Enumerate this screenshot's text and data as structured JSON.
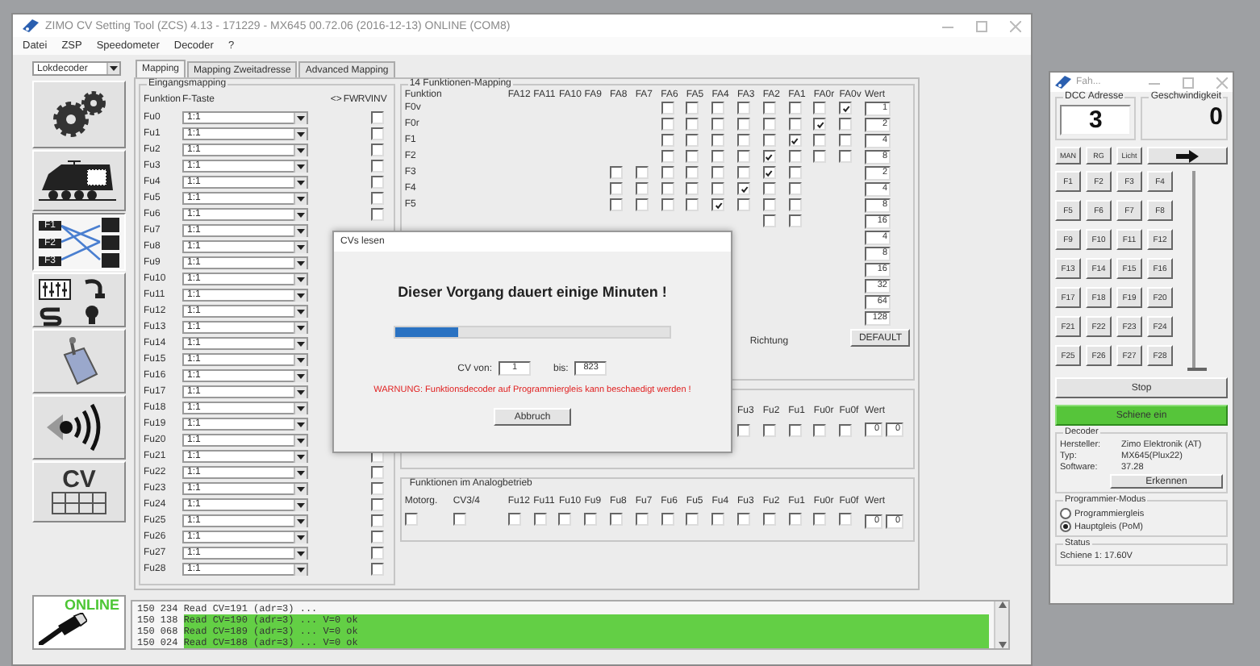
{
  "window": {
    "title": "ZIMO CV Setting Tool (ZCS) 4.13 - 171229 - MX645 00.72.06 (2016-12-13) ONLINE (COM8)"
  },
  "menu": [
    "Datei",
    "ZSP",
    "Speedometer",
    "Decoder",
    "?"
  ],
  "decoder_type": {
    "value": "Lokdecoder"
  },
  "tools": [
    {
      "kind": "gears",
      "selected": false
    },
    {
      "kind": "locomotive",
      "selected": false
    },
    {
      "kind": "mapping",
      "selected": true,
      "labels": [
        "F1",
        "F2",
        "F3"
      ]
    },
    {
      "kind": "settings",
      "selected": false
    },
    {
      "kind": "servo",
      "selected": false
    },
    {
      "kind": "sound",
      "selected": false
    },
    {
      "kind": "cv",
      "selected": false,
      "label": "CV"
    }
  ],
  "tabs": [
    {
      "label": "Mapping",
      "selected": true
    },
    {
      "label": "Mapping Zweitadresse",
      "selected": false
    },
    {
      "label": "Advanced Mapping",
      "selected": false
    }
  ],
  "input_mapping": {
    "title": "Eingangsmapping",
    "columns": [
      "Funktion",
      "F-Taste",
      "<>",
      "FW",
      "RV",
      "INV"
    ],
    "rows": [
      {
        "label": "Fu0",
        "key": "1:1",
        "inv": false
      },
      {
        "label": "Fu1",
        "key": "1:1",
        "inv": false
      },
      {
        "label": "Fu2",
        "key": "1:1",
        "inv": false
      },
      {
        "label": "Fu3",
        "key": "1:1",
        "inv": false
      },
      {
        "label": "Fu4",
        "key": "1:1",
        "inv": false
      },
      {
        "label": "Fu5",
        "key": "1:1",
        "inv": false
      },
      {
        "label": "Fu6",
        "key": "1:1",
        "inv": false
      },
      {
        "label": "Fu7",
        "key": "1:1"
      },
      {
        "label": "Fu8",
        "key": "1:1"
      },
      {
        "label": "Fu9",
        "key": "1:1"
      },
      {
        "label": "Fu10",
        "key": "1:1"
      },
      {
        "label": "Fu11",
        "key": "1:1"
      },
      {
        "label": "Fu12",
        "key": "1:1"
      },
      {
        "label": "Fu13",
        "key": "1:1"
      },
      {
        "label": "Fu14",
        "key": "1:1"
      },
      {
        "label": "Fu15",
        "key": "1:1"
      },
      {
        "label": "Fu16",
        "key": "1:1"
      },
      {
        "label": "Fu17",
        "key": "1:1"
      },
      {
        "label": "Fu18",
        "key": "1:1"
      },
      {
        "label": "Fu19",
        "key": "1:1"
      },
      {
        "label": "Fu20",
        "key": "1:1"
      },
      {
        "label": "Fu21",
        "key": "1:1",
        "inv": false
      },
      {
        "label": "Fu22",
        "key": "1:1",
        "inv": false
      },
      {
        "label": "Fu23",
        "key": "1:1",
        "inv": false
      },
      {
        "label": "Fu24",
        "key": "1:1",
        "inv": false
      },
      {
        "label": "Fu25",
        "key": "1:1",
        "inv": false
      },
      {
        "label": "Fu26",
        "key": "1:1",
        "inv": false
      },
      {
        "label": "Fu27",
        "key": "1:1",
        "inv": false
      },
      {
        "label": "Fu28",
        "key": "1:1",
        "inv": false
      }
    ]
  },
  "output_mapping": {
    "title": "14 Funktionen-Mapping",
    "columns": [
      "Funktion",
      "FA12",
      "FA11",
      "FA10",
      "FA9",
      "FA8",
      "FA7",
      "FA6",
      "FA5",
      "FA4",
      "FA3",
      "FA2",
      "FA1",
      "FA0r",
      "FA0v",
      "Wert"
    ],
    "rows": [
      {
        "label": "F0v",
        "kind": "lower",
        "outputs": [
          false,
          false,
          false,
          false,
          false,
          false,
          false,
          true
        ],
        "value": "1"
      },
      {
        "label": "F0r",
        "kind": "lower",
        "outputs": [
          false,
          false,
          false,
          false,
          false,
          false,
          true,
          false
        ],
        "value": "2"
      },
      {
        "label": "F1",
        "kind": "lower",
        "outputs": [
          false,
          false,
          false,
          false,
          false,
          true,
          false,
          false
        ],
        "value": "4"
      },
      {
        "label": "F2",
        "kind": "lower",
        "outputs": [
          false,
          false,
          false,
          false,
          true,
          false,
          false,
          false
        ],
        "value": "8"
      },
      {
        "label": "F3",
        "kind": "upper",
        "outputs": [
          false,
          false,
          false,
          false,
          false,
          false,
          true,
          false
        ],
        "value": "2"
      },
      {
        "label": "F4",
        "kind": "upper",
        "outputs": [
          false,
          false,
          false,
          false,
          false,
          true,
          false,
          false
        ],
        "value": "4"
      },
      {
        "label": "F5",
        "kind": "upper",
        "outputs": [
          false,
          false,
          false,
          false,
          true,
          false,
          false,
          false
        ],
        "value": "8"
      },
      {
        "kind": "upper",
        "outputs": [
          false,
          false
        ],
        "value": "16"
      },
      {
        "value": "4"
      },
      {
        "value": "8"
      },
      {
        "value": "16"
      },
      {
        "value": "32"
      },
      {
        "value": "64"
      },
      {
        "value": "128"
      }
    ],
    "direction_label": "Richtung",
    "default_button": "DEFAULT"
  },
  "second_mapping": {
    "columns": [
      "Fu3",
      "Fu2",
      "Fu1",
      "Fu0r",
      "Fu0f",
      "Wert"
    ],
    "checks": [
      false,
      false,
      false,
      false,
      false
    ],
    "values": [
      "0",
      "0"
    ]
  },
  "analog": {
    "title": "Funktionen im Analogbetrieb",
    "columns": [
      "Motorg.",
      "CV3/4",
      "Fu12",
      "Fu11",
      "Fu10",
      "Fu9",
      "Fu8",
      "Fu7",
      "Fu6",
      "Fu5",
      "Fu4",
      "Fu3",
      "Fu2",
      "Fu1",
      "Fu0r",
      "Fu0f",
      "Wert"
    ],
    "checks": [
      false,
      false,
      false,
      false,
      false,
      false,
      false,
      false,
      false,
      false,
      false,
      false,
      false,
      false,
      false,
      false
    ],
    "values": [
      "0",
      "0"
    ]
  },
  "connection": {
    "label": "ONLINE",
    "online": true
  },
  "log": [
    {
      "time": "150 234",
      "text": "Read CV=191 (adr=3) ...",
      "ok": false
    },
    {
      "time": "150 138",
      "text": "Read CV=190 (adr=3) ... V=0 ok",
      "ok": true
    },
    {
      "time": "150 068",
      "text": "Read CV=189 (adr=3) ... V=0 ok",
      "ok": true
    },
    {
      "time": "150 024",
      "text": "Read CV=188 (adr=3) ... V=0 ok",
      "ok": true
    }
  ],
  "dialog": {
    "title": "CVs lesen",
    "message": "Dieser Vorgang dauert einige Minuten !",
    "progress": {
      "level": 0.23
    },
    "from_label": "CV von:",
    "from": "1",
    "to_label": "bis:",
    "to": "823",
    "warning": "WARNUNG: Funktionsdecoder auf Programmiergleis kann beschaedigt werden !",
    "button": "Abbruch"
  },
  "throttle": {
    "title": "Fah...",
    "address_label": "DCC Adresse",
    "address": "3",
    "speed_label": "Geschwindigkeit",
    "speed": "0",
    "buttons": [
      "MAN",
      "RG",
      "Licht"
    ],
    "functions": [
      "F1",
      "F2",
      "F3",
      "F4",
      "F5",
      "F6",
      "F7",
      "F8",
      "F9",
      "F10",
      "F11",
      "F12",
      "F13",
      "F14",
      "F15",
      "F16",
      "F17",
      "F18",
      "F19",
      "F20",
      "F21",
      "F22",
      "F23",
      "F24",
      "F25",
      "F26",
      "F27",
      "F28"
    ],
    "slider": {
      "level": 0
    },
    "stop": "Stop",
    "track": {
      "label": "Schiene ein",
      "on": true
    },
    "decoder": {
      "title": "Decoder",
      "fields": [
        {
          "label": "Hersteller:",
          "value": "Zimo Elektronik (AT)"
        },
        {
          "label": "Typ:",
          "value": "MX645(Plux22)"
        },
        {
          "label": "Software:",
          "value": "37.28"
        }
      ],
      "button": "Erkennen"
    },
    "mode": {
      "title": "Programmier-Modus",
      "options": [
        {
          "label": "Programmiergleis",
          "selected": false
        },
        {
          "label": "Hauptgleis (PoM)",
          "selected": true
        }
      ]
    },
    "status": {
      "title": "Status",
      "text": "Schiene 1: 17.60V"
    }
  }
}
